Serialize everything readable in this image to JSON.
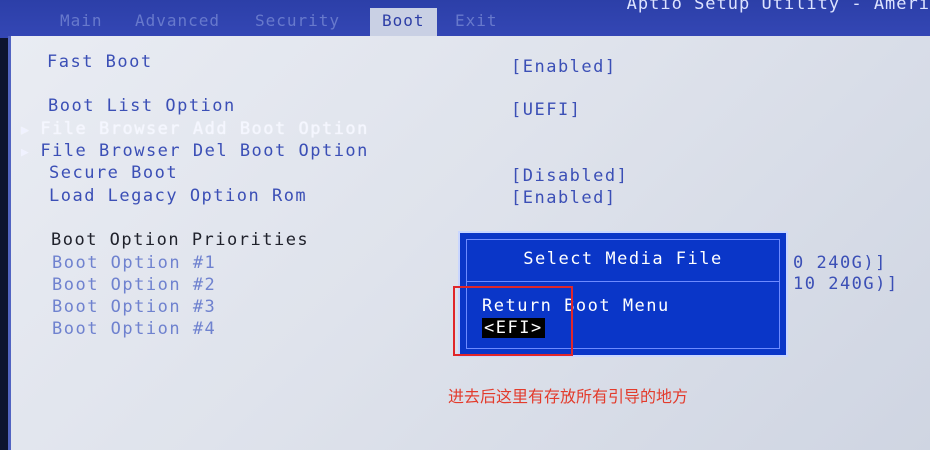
{
  "header": {
    "title": "Aptio Setup Utility - Ameri",
    "tabs": [
      {
        "label": "Main"
      },
      {
        "label": "Advanced"
      },
      {
        "label": "Security"
      },
      {
        "label": "Boot"
      },
      {
        "label": "Exit"
      }
    ]
  },
  "boot": {
    "fast_boot": {
      "label": "Fast Boot",
      "value": "[Enabled]"
    },
    "boot_list_option": {
      "label": "Boot List Option",
      "value": "[UEFI]"
    },
    "file_browser_add": {
      "label": "File Browser Add Boot Option"
    },
    "file_browser_del": {
      "label": "File Browser Del Boot Option"
    },
    "secure_boot": {
      "label": "Secure Boot",
      "value": "[Disabled]"
    },
    "load_legacy": {
      "label": "Load Legacy Option Rom",
      "value": "[Enabled]"
    },
    "priorities_heading": "Boot Option Priorities",
    "options": [
      {
        "label": "Boot Option #1",
        "value": "0 240G)]"
      },
      {
        "label": "Boot Option #2",
        "value": "10 240G)]"
      },
      {
        "label": "Boot Option #3"
      },
      {
        "label": "Boot Option #4"
      }
    ]
  },
  "dialog": {
    "title": "Select Media File",
    "items": [
      {
        "label": "Return Boot Menu"
      },
      {
        "label": "<EFI>"
      }
    ]
  },
  "annotation": "进去后这里有存放所有引导的地方",
  "colors": {
    "dialog_bg": "#0a36c8",
    "annotation": "#e33b2c",
    "redbox": "#e0262a"
  }
}
